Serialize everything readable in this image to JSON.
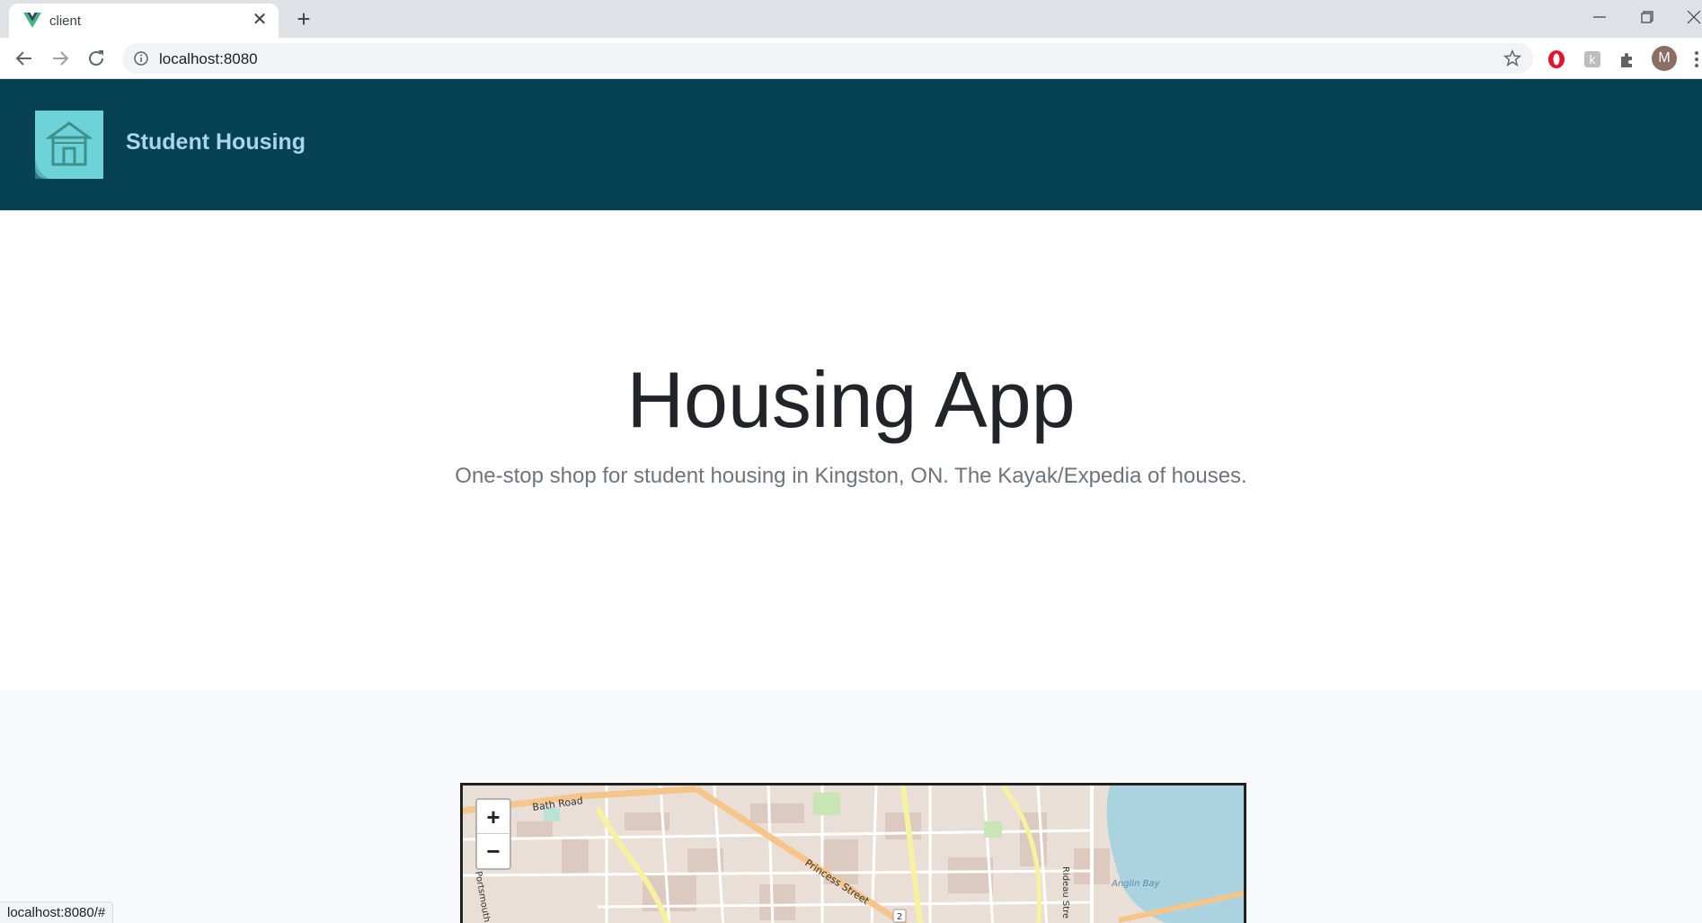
{
  "browser": {
    "tab_title": "client",
    "url": "localhost:8080",
    "status_url": "localhost:8080/#",
    "avatar_initial": "M"
  },
  "app": {
    "brand": "Student Housing",
    "header_color": "#064252",
    "brand_color": "#a9d5f2"
  },
  "hero": {
    "title": "Housing App",
    "subtitle": "One-stop shop for student housing in Kingston, ON. The Kayak/Expedia of houses."
  },
  "map": {
    "zoom_in_label": "+",
    "zoom_out_label": "−",
    "labels": {
      "bath_road": "Bath Road",
      "princess_street": "Princess Street",
      "rideau_street": "Rideau Stre",
      "portsmouth": "Portsmouth",
      "anglin_bay": "Anglin Bay",
      "route_shield": "2"
    }
  },
  "icons": {
    "tab_close": "close-icon",
    "new_tab": "plus-icon",
    "back": "arrow-left-icon",
    "forward": "arrow-right-icon",
    "reload": "reload-icon",
    "info": "info-icon",
    "star": "star-icon",
    "extensions": "puzzle-icon",
    "logo": "house-icon"
  }
}
